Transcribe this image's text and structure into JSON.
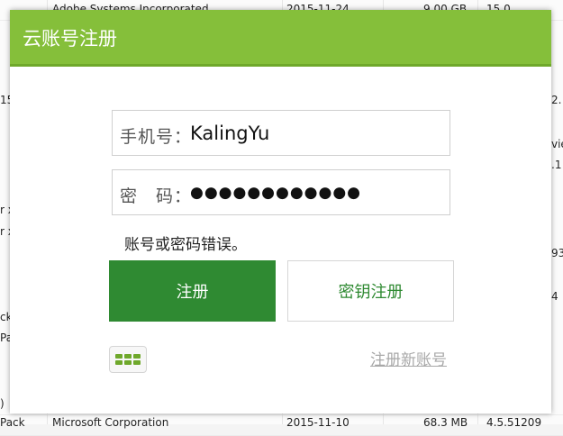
{
  "background": {
    "row1": {
      "c1": "Adobe Systems Incorporated",
      "c2": "2015-11-24",
      "c3": "9.00 GB",
      "c4": "15.0"
    },
    "left_fragments": [
      "15",
      "r x",
      "r x",
      "ck",
      "Pa",
      ")"
    ],
    "right_fragments": [
      "2.",
      "vie",
      ".1",
      "93",
      "4"
    ],
    "bottom_row": {
      "c1": "Microsoft Corporation",
      "c2": "2015-11-10",
      "c3": "68.3 MB",
      "c4": "4.5.51209"
    },
    "bottom_left": "Pack"
  },
  "dialog": {
    "title": "云账号注册",
    "phone": {
      "label": "手机号：",
      "value": "KalingYu"
    },
    "password": {
      "label": "密　码：",
      "value": "●●●●●●●●●●●●"
    },
    "error_message": "账号或密码错误。",
    "register_button": "注册",
    "key_register_button": "密钥注册",
    "register_new_link": "注册新账号",
    "keyboard_icon": "keyboard-icon"
  },
  "colors": {
    "titlebar": "#85bf3a",
    "primary_button": "#2f8a32",
    "link": "#a8a8a8"
  }
}
